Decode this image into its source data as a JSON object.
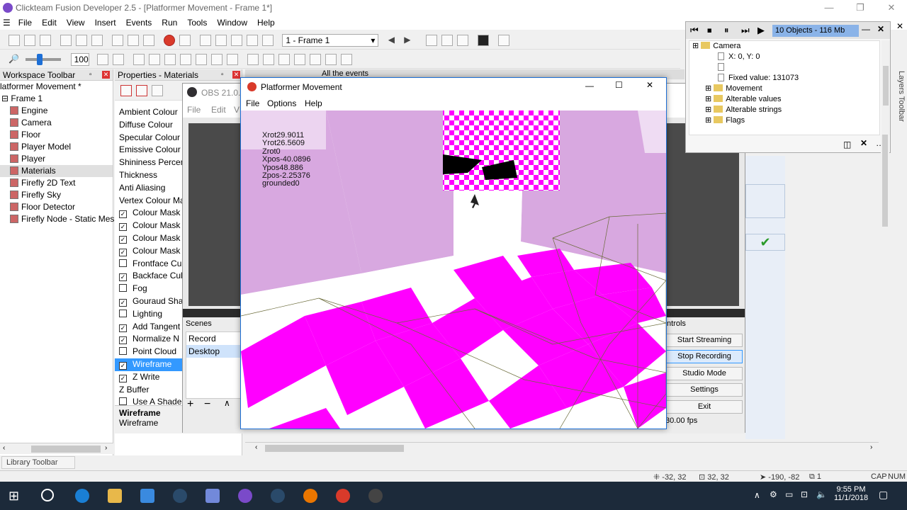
{
  "window": {
    "title": "Clickteam Fusion Developer 2.5 - [Platformer Movement - Frame 1*]",
    "min": "—",
    "max": "❐",
    "close": "✕"
  },
  "menubar": {
    "items": [
      "File",
      "Edit",
      "View",
      "Insert",
      "Events",
      "Run",
      "Tools",
      "Window",
      "Help"
    ]
  },
  "toolbar": {
    "frame_combo": "1 - Frame 1",
    "zoom_value": "100"
  },
  "workspace": {
    "title": "Workspace Toolbar",
    "root": "latformer Movement *",
    "frame": "Frame 1",
    "items": [
      "Engine",
      "Camera",
      "Floor",
      "Player Model",
      "Player",
      "Materials",
      "Firefly 2D Text",
      "Firefly Sky",
      "Floor Detector",
      "Firefly Node - Static Mesh"
    ]
  },
  "properties": {
    "title": "Properties - Materials",
    "rows": [
      {
        "label": "Ambient Colour",
        "check": null
      },
      {
        "label": "Diffuse Colour",
        "check": null
      },
      {
        "label": "Specular Colour",
        "check": null
      },
      {
        "label": "Emissive Colour",
        "check": null
      },
      {
        "label": "Shininess Percent",
        "check": null
      },
      {
        "label": "Thickness",
        "check": null
      },
      {
        "label": "Anti Aliasing",
        "check": null
      },
      {
        "label": "Vertex Colour Ma",
        "check": null
      },
      {
        "label": "Colour Mask",
        "check": true
      },
      {
        "label": "Colour Mask",
        "check": true
      },
      {
        "label": "Colour Mask",
        "check": true
      },
      {
        "label": "Colour Mask",
        "check": true
      },
      {
        "label": "Frontface Cu",
        "check": false
      },
      {
        "label": "Backface Cul",
        "check": true
      },
      {
        "label": "Fog",
        "check": false
      },
      {
        "label": "Gouraud Sha",
        "check": true
      },
      {
        "label": "Lighting",
        "check": false
      },
      {
        "label": "Add Tangent",
        "check": true
      },
      {
        "label": "Normalize N",
        "check": true
      },
      {
        "label": "Point Cloud",
        "check": false
      },
      {
        "label": "Wireframe",
        "check": true
      },
      {
        "label": "Z Write",
        "check": true
      },
      {
        "label": "Z Buffer",
        "check": null
      },
      {
        "label": "Use A Shader",
        "check": false
      }
    ],
    "selected_index": 20,
    "desc_title": "Wireframe",
    "desc_text": "Wireframe"
  },
  "obs": {
    "title": "OBS 21.0.1",
    "menu": [
      "File",
      "Edit",
      "V"
    ],
    "scenes_label": "Scenes",
    "scenes": [
      "Record",
      "Desktop"
    ],
    "controls_label": "ntrols",
    "buttons": [
      "Start Streaming",
      "Stop Recording",
      "Studio Mode",
      "Settings",
      "Exit"
    ],
    "fps": "30.00 fps"
  },
  "events_header": "All the events",
  "game": {
    "title": "Platformer Movement",
    "menu": [
      "File",
      "Options",
      "Help"
    ],
    "debug": [
      "Xrot29.9011",
      "Yrot26.5609",
      "Zrot0",
      "Xpos-40.0896",
      "Ypos48.886",
      "Zpos-2.25376",
      "grounded0"
    ]
  },
  "debugger": {
    "info": "10 Objects - 116 Mb",
    "tree": [
      {
        "label": "Camera",
        "indent": 0,
        "type": "folder"
      },
      {
        "label": "X: 0, Y: 0",
        "indent": 2,
        "type": "file"
      },
      {
        "label": "",
        "indent": 2,
        "type": "file"
      },
      {
        "label": "Fixed value: 131073",
        "indent": 2,
        "type": "file"
      },
      {
        "label": "Movement",
        "indent": 1,
        "type": "folder"
      },
      {
        "label": "Alterable values",
        "indent": 1,
        "type": "folder"
      },
      {
        "label": "Alterable strings",
        "indent": 1,
        "type": "folder"
      },
      {
        "label": "Flags",
        "indent": 1,
        "type": "folder"
      }
    ]
  },
  "layers_toolbar": "Layers Toolbar",
  "library_toolbar": "Library Toolbar",
  "status": {
    "pos1": "-32, 32",
    "pos2": "32, 32",
    "pos3": "-190, -82",
    "pos4": "1",
    "caps": "CAP",
    "num": "NUM"
  },
  "clock": {
    "time": "9:55 PM",
    "date": "11/1/2018"
  }
}
